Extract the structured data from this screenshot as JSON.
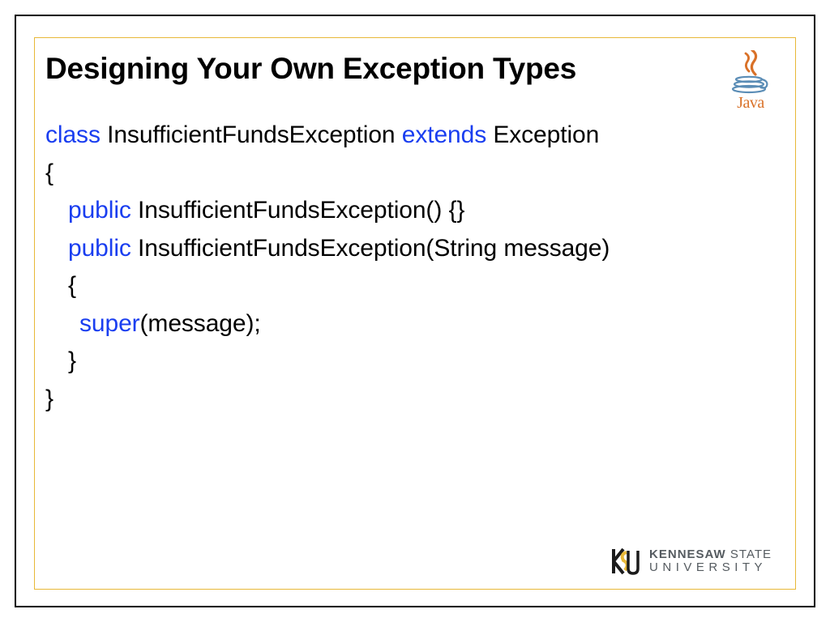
{
  "title": "Designing Your Own Exception Types",
  "logo": {
    "label": "Java"
  },
  "code": {
    "l0": {
      "kw1": "class",
      "t1": " InsufficientFundsException ",
      "kw2": "extends",
      "t2": " Exception"
    },
    "l1": "{",
    "l2": {
      "kw": "public",
      "t": " InsufficientFundsException() {}"
    },
    "l3": {
      "kw": "public",
      "t": " InsufficientFundsException(String message)"
    },
    "l4": "{",
    "l5": {
      "kw": "super",
      "t": "(message);"
    },
    "l6": "}",
    "l7": "}"
  },
  "footer": {
    "ksu_line1a": "KENNESAW",
    "ksu_line1b": " STATE",
    "ksu_line2": "UNIVERSITY"
  }
}
